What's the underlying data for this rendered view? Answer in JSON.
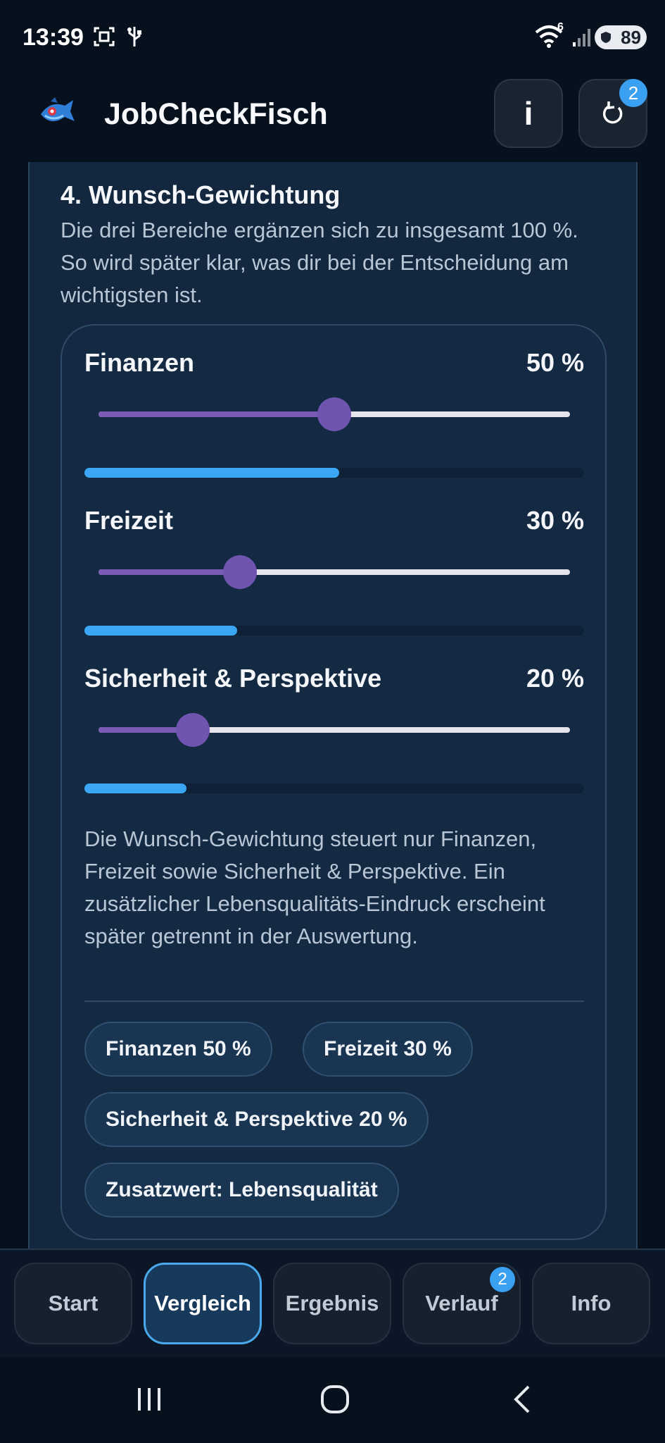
{
  "status_bar": {
    "time": "13:39",
    "wifi_badge": "6",
    "battery": "89",
    "icons": [
      "screenshot-icon",
      "usb-icon",
      "wifi-icon",
      "signal-icon",
      "battery-icon"
    ]
  },
  "header": {
    "title": "JobCheckFisch",
    "info_label": "i",
    "reset_badge": "2"
  },
  "section": {
    "title": "4. Wunsch-Gewichtung",
    "description": "Die drei Bereiche ergänzen sich zu insgesamt 100 %. So wird später klar, was dir bei der Entscheidung am wichtigsten ist."
  },
  "sliders": [
    {
      "label": "Finanzen",
      "value_text": "50 %",
      "value": 50
    },
    {
      "label": "Freizeit",
      "value_text": "30 %",
      "value": 30
    },
    {
      "label": "Sicherheit & Perspektive",
      "value_text": "20 %",
      "value": 20
    }
  ],
  "note": "Die Wunsch-Gewichtung steuert nur Finanzen, Freizeit sowie Sicherheit & Perspektive. Ein zusätzlicher Lebensqualitäts-Eindruck erscheint später getrennt in der Auswertung.",
  "chips": [
    "Finanzen 50 %",
    "Freizeit 30 %",
    "Sicherheit & Perspektive 20 %",
    "Zusatzwert: Lebensqualität"
  ],
  "bottom_nav": {
    "items": [
      "Start",
      "Vergleich",
      "Ergebnis",
      "Verlauf",
      "Info"
    ],
    "active": "Vergleich",
    "verlauf_badge": "2"
  },
  "colors": {
    "accent": "#3aa6f5",
    "slider": "#6f54b0",
    "background": "#06111d",
    "card": "#13273e"
  }
}
